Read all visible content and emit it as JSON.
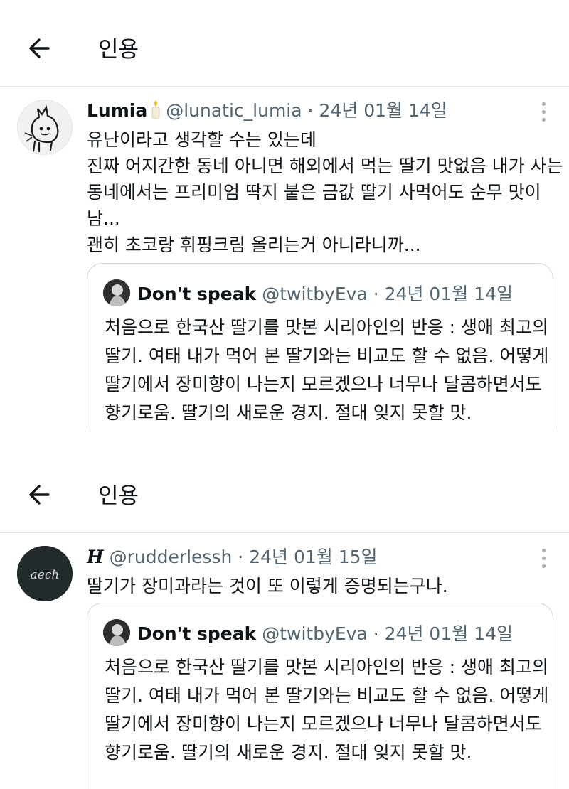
{
  "screens": [
    {
      "header": {
        "title": "인용"
      },
      "post": {
        "author_name": "Lumia",
        "author_handle": "@lunatic_lumia",
        "separator": "·",
        "date": "24년 01월 14일",
        "body_lines": [
          "유난이라고 생각할 수는 있는데",
          "진짜 어지간한 동네 아니면 해외에서 먹는 딸기 맛없음 내가 사는",
          "동네에서는 프리미엄 딱지 붙은 금값 딸기 사먹어도 순무 맛이",
          "남...",
          "괜히 초코랑 휘핑크림 올리는거 아니라니까..."
        ]
      },
      "quote": {
        "author_name": "Don't speak",
        "author_handle": "@twitbyEva",
        "separator": "·",
        "date": "24년 01월 14일",
        "body_lines": [
          "처음으로 한국산 딸기를 맛본 시리아인의 반응 : 생애 최고의",
          "딸기. 여태 내가 먹어 본 딸기와는 비교도 할 수 없음. 어떻게",
          "딸기에서 장미향이 나는지 모르겠으나 너무나 달콤하면서도",
          "향기로움. 딸기의 새로운 경지. 절대 잊지 못할 맛."
        ]
      }
    },
    {
      "header": {
        "title": "인용"
      },
      "post": {
        "author_name": "H",
        "author_handle": "@rudderlessh",
        "separator": "·",
        "date": "24년 01월 15일",
        "avatar_text": "aech",
        "body_lines": [
          "딸기가 장미과라는 것이 또 이렇게 증명되는구나."
        ]
      },
      "quote": {
        "author_name": "Don't speak",
        "author_handle": "@twitbyEva",
        "separator": "·",
        "date": "24년 01월 14일",
        "body_lines": [
          "처음으로 한국산 딸기를 맛본 시리아인의 반응 : 생애 최고의",
          "딸기. 여태 내가 먹어 본 딸기와는 비교도 할 수 없음. 어떻게",
          "딸기에서 장미향이 나는지 모르겠으나 너무나 달콤하면서도",
          "향기로움. 딸기의 새로운 경지. 절대 잊지 못할 맛."
        ]
      }
    }
  ],
  "icons": {
    "back": "arrow-left-icon",
    "more": "more-vertical-icon",
    "candle": "candle-emoji-icon"
  },
  "colors": {
    "text": "#0f1419",
    "secondary": "#536471",
    "border": "#cfd9de",
    "divider": "#e1e6ea"
  }
}
